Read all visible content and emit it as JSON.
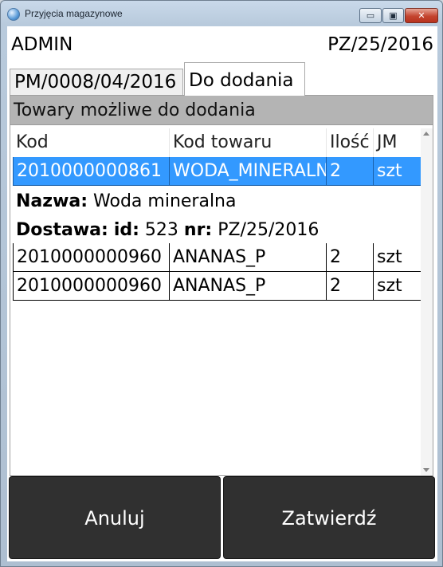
{
  "window": {
    "title": "Przyjęcia magazynowe",
    "min_glyph": "▭",
    "max_glyph": "▣",
    "close_glyph": "✕"
  },
  "header": {
    "user": "ADMIN",
    "document": "PZ/25/2016"
  },
  "tabs": [
    {
      "label": "PM/0008/04/2016",
      "active": false
    },
    {
      "label": "Do dodania",
      "active": true
    }
  ],
  "panel": {
    "title": "Towary możliwe do dodania",
    "columns": [
      "Kod",
      "Kod towaru",
      "Ilość",
      "JM"
    ],
    "rows": [
      {
        "kod": "2010000000861",
        "kod_towaru": "WODA_MINERALNA",
        "ilosc": "2",
        "jm": "szt",
        "selected": true
      },
      {
        "kod": "2010000000960",
        "kod_towaru": "ANANAS_P",
        "ilosc": "2",
        "jm": "szt",
        "selected": false
      },
      {
        "kod": "2010000000960",
        "kod_towaru": "ANANAS_P",
        "ilosc": "2",
        "jm": "szt",
        "selected": false
      }
    ],
    "detail": {
      "nazwa_label": "Nazwa:",
      "nazwa_value": "Woda mineralna",
      "dostawa_label": "Dostawa:",
      "id_label": "id:",
      "id_value": "523",
      "nr_label": "nr:",
      "nr_value": "PZ/25/2016"
    }
  },
  "buttons": {
    "cancel": "Anuluj",
    "confirm": "Zatwierdź"
  },
  "colors": {
    "selection": "#3399ff",
    "button_bg": "#303030",
    "header_bg": "#b4b4b4"
  }
}
